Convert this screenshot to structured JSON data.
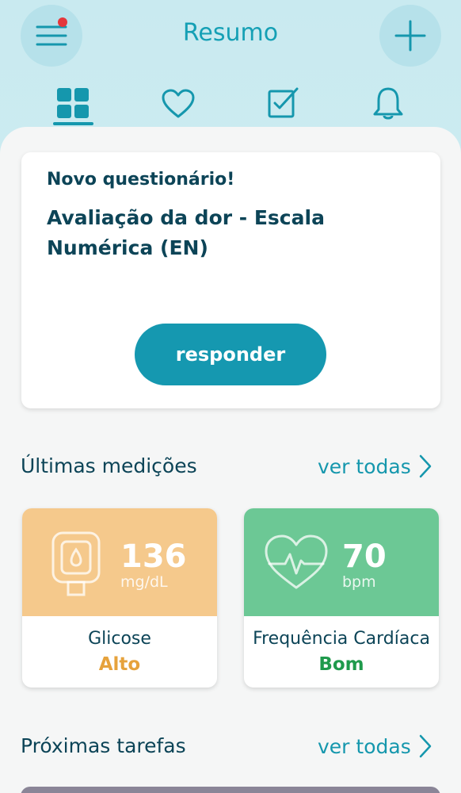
{
  "header": {
    "title": "Resumo",
    "menu_icon": "hamburger-menu-icon",
    "add_icon": "plus-icon",
    "notification_dot_color": "#e5373b"
  },
  "tabs": [
    {
      "icon": "dashboard-grid-icon",
      "active": true
    },
    {
      "icon": "heart-icon",
      "active": false
    },
    {
      "icon": "clipboard-check-icon",
      "active": false
    },
    {
      "icon": "bell-icon",
      "active": false
    }
  ],
  "questionnaire": {
    "label": "Novo questionário!",
    "title": "Avaliação da dor - Escala Numérica (EN)",
    "button_label": "responder"
  },
  "measurements": {
    "section_title": "Últimas medições",
    "see_all": "ver todas",
    "items": [
      {
        "icon": "glucometer-icon",
        "value": "136",
        "unit": "mg/dL",
        "name": "Glicose",
        "status": "Alto",
        "color": "#f5c98c",
        "status_color": "#e6a23c"
      },
      {
        "icon": "heart-rate-icon",
        "value": "70",
        "unit": "bpm",
        "name": "Frequência Cardíaca",
        "status": "Bom",
        "color": "#6cc895",
        "status_color": "#1f9a4c"
      }
    ]
  },
  "tasks": {
    "section_title": "Próximas tarefas",
    "see_all": "ver todas"
  }
}
